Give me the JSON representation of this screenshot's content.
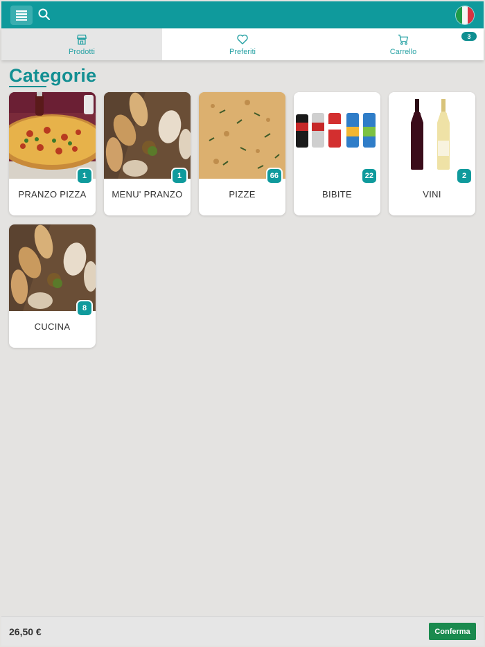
{
  "header": {
    "menu_icon": "menu-icon",
    "search_icon": "search-icon",
    "flag_icon": "italy-flag-icon",
    "bar_color": "#0f9a9c"
  },
  "tabs": [
    {
      "label": "Prodotti",
      "icon": "store-icon",
      "active": true
    },
    {
      "label": "Preferiti",
      "icon": "heart-icon",
      "active": false
    },
    {
      "label": "Carrello",
      "icon": "cart-icon",
      "active": false,
      "badge": "3"
    }
  ],
  "main": {
    "title": "Categorie",
    "categories": [
      {
        "label": "PRANZO PIZZA",
        "count": "1"
      },
      {
        "label": "MENU' PRANZO",
        "count": "1"
      },
      {
        "label": "PIZZE",
        "count": "66"
      },
      {
        "label": "BIBITE",
        "count": "22"
      },
      {
        "label": "VINI",
        "count": "2"
      },
      {
        "label": "CUCINA",
        "count": "8"
      }
    ]
  },
  "footer": {
    "total": "26,50 €",
    "confirm_label": "Conferma",
    "confirm_color": "#1a8a4e"
  }
}
